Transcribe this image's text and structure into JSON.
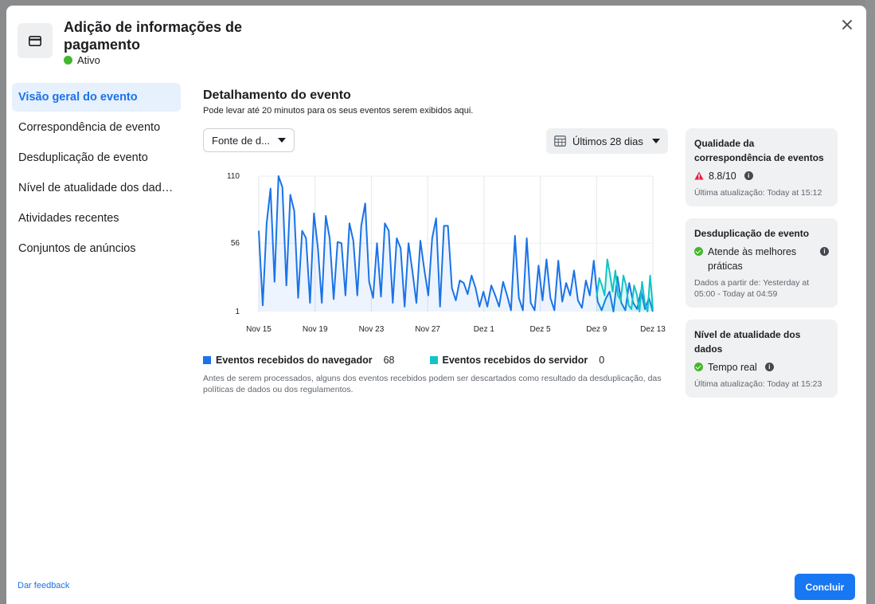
{
  "header": {
    "title": "Adição de informações de pagamento",
    "status": "Ativo",
    "icon": "credit-card-icon"
  },
  "sidebar": {
    "items": [
      {
        "label": "Visão geral do evento",
        "active": true
      },
      {
        "label": "Correspondência de evento",
        "active": false
      },
      {
        "label": "Desduplicação de evento",
        "active": false
      },
      {
        "label": "Nível de atualidade dos dad…",
        "active": false
      },
      {
        "label": "Atividades recentes",
        "active": false
      },
      {
        "label": "Conjuntos de anúncios",
        "active": false
      }
    ]
  },
  "main": {
    "title": "Detalhamento do evento",
    "subtitle": "Pode levar até 20 minutos para os seus eventos serem exibidos aqui.",
    "source_dropdown": "Fonte de d...",
    "date_dropdown": "Últimos 28 dias",
    "legend": {
      "browser_label": "Eventos recebidos do navegador",
      "browser_value": "68",
      "server_label": "Eventos recebidos do servidor",
      "server_value": "0"
    },
    "note": "Antes de serem processados, alguns dos eventos recebidos podem ser descartados como resultado da desduplicação, das políticas de dados ou dos regulamentos."
  },
  "chart_data": {
    "type": "line",
    "xticks": [
      "Nov 15",
      "Nov 19",
      "Nov 23",
      "Nov 27",
      "Dez 1",
      "Dez 5",
      "Dez 9",
      "Dez 13"
    ],
    "yticks": [
      "110",
      "56",
      "1"
    ],
    "ylim": [
      1,
      110
    ],
    "colors": {
      "browser": "#1a73e8",
      "server": "#12c4c4"
    },
    "series": [
      {
        "name": "Eventos recebidos do navegador",
        "values": [
          66,
          6,
          72,
          100,
          25,
          110,
          101,
          22,
          95,
          82,
          12,
          66,
          60,
          8,
          80,
          52,
          8,
          78,
          60,
          11,
          57,
          56,
          14,
          72,
          58,
          14,
          70,
          88,
          25,
          12,
          56,
          13,
          72,
          66,
          8,
          60,
          52,
          5,
          56,
          33,
          8,
          58,
          35,
          14,
          60,
          76,
          5,
          70,
          70,
          20,
          10,
          26,
          24,
          15,
          30,
          20,
          5,
          17,
          5,
          22,
          14,
          5,
          25,
          14,
          2,
          62,
          12,
          2,
          60,
          8,
          2,
          38,
          10,
          43,
          12,
          2,
          42,
          9,
          24,
          14,
          34,
          10,
          4,
          26,
          14,
          42,
          9,
          2,
          11,
          17,
          1,
          29,
          8,
          2,
          24,
          8,
          3,
          18,
          3,
          12,
          1
        ]
      },
      {
        "name": "Eventos recebidos do servidor",
        "values": [
          12,
          28,
          22,
          14,
          43,
          31,
          17,
          34,
          14,
          10,
          30,
          22,
          6,
          3,
          22,
          15,
          1,
          25,
          8,
          1,
          30,
          3
        ]
      }
    ]
  },
  "cards": [
    {
      "title": "Qualidade da correspondência de eventos",
      "value": "8.8/10",
      "meta": "Última atualização: Today at 15:12"
    },
    {
      "title": "Desduplicação de evento",
      "value": "Atende às melhores práticas",
      "meta": "Dados a partir de: Yesterday at 05:00 - Today at 04:59"
    },
    {
      "title": "Nível de atualidade dos dados",
      "value": "Tempo real",
      "meta": "Última atualização: Today at 15:23"
    }
  ],
  "footer": {
    "feedback": "Dar feedback",
    "done": "Concluir"
  }
}
